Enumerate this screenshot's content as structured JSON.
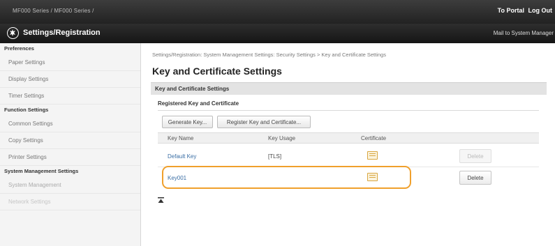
{
  "topbar": {
    "model": "MF000 Series / MF000 Series /",
    "portal_link": "To Portal",
    "logout_link": "Log Out"
  },
  "header": {
    "title": "Settings/Registration",
    "mail_link": "Mail to System Manager"
  },
  "sidebar": {
    "sections": [
      {
        "heading": "Preferences",
        "items": [
          "Paper Settings",
          "Display Settings",
          "Timer Settings"
        ]
      },
      {
        "heading": "Function Settings",
        "items": [
          "Common Settings",
          "Copy Settings",
          "Printer Settings"
        ]
      },
      {
        "heading": "System Management Settings",
        "items": [
          "System Management",
          "Network Settings"
        ]
      }
    ]
  },
  "main": {
    "breadcrumb": "Settings/Registration: System Management Settings: Security Settings > Key and Certificate Settings",
    "page_title": "Key and Certificate Settings",
    "section_title": "Key and Certificate Settings",
    "subsection_title": "Registered Key and Certificate",
    "buttons": {
      "generate_key": "Generate Key...",
      "register_key": "Register Key and Certificate..."
    },
    "table": {
      "headers": [
        "Key Name",
        "Key Usage",
        "Certificate"
      ],
      "rows": [
        {
          "name": "Default Key",
          "usage": "[TLS]",
          "certificate_icon": "certificate-icon",
          "delete": "Delete",
          "delete_enabled": false
        },
        {
          "name": "Key001",
          "usage": "",
          "certificate_icon": "certificate-icon",
          "delete": "Delete",
          "delete_enabled": true
        }
      ]
    },
    "highlight_color": "#f0a02c"
  }
}
